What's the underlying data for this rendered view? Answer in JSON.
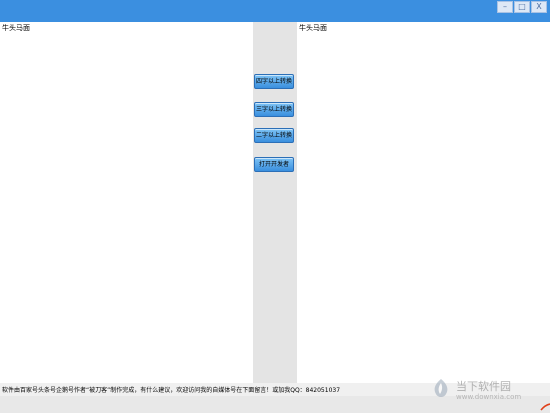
{
  "window": {
    "controls": {
      "minimize": "–",
      "maximize": "□",
      "close": "X"
    }
  },
  "left_pane": {
    "text": "牛头马面"
  },
  "right_pane": {
    "text": "牛头马面"
  },
  "buttons": {
    "four_char": "四字以上转换",
    "three_char": "三字以上转换",
    "two_char": "二字以上转换",
    "open_folder": "打开开发者"
  },
  "status": {
    "text": "软件由百家号头条号企鹅号作者“被刀客”制作完成，有什么建议，欢迎访问我的自媒体号在下面留言！或加我QQ：842051037"
  },
  "watermark": {
    "name": "当下软件园",
    "url": "www.downxia.com",
    "logo_icon": "downxia-logo-icon"
  },
  "colors": {
    "titlebar": "#3b8fe0",
    "button": "#5aa8ec",
    "middle_panel": "#e4e4e4"
  }
}
